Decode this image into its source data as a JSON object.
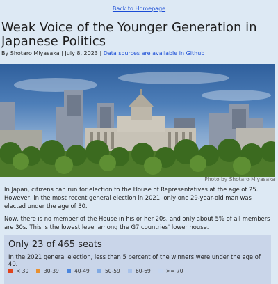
{
  "nav": {
    "back_label": "Back to Homepage"
  },
  "article": {
    "title": "Weak Voice of the Younger Generation in Japanese Politics",
    "author": "By Shotaro Miyasaka",
    "date": "July 8, 2023",
    "sources_link": "Data sources are available in Github",
    "photo_credit": "Photo by Shotaro Miyasaka",
    "paragraphs": [
      "In Japan, citizens can run for election to the House of Representatives at the age of 25. However, in the most recent general election in 2021, only one 29-year-old man was elected under the age of 30.",
      "Now, there is no member of the House in his or her 20s, and only about 5% of all members are 30s. This is the lowest level among the G7 countries' lower house."
    ]
  },
  "card": {
    "title": "Only 23 of 465 seats",
    "subtitle": "In the 2021 general election, less than 5 percent of the winners were under the age of 40.",
    "legend": [
      {
        "label": "< 30",
        "color": "#e0441c"
      },
      {
        "label": "30-39",
        "color": "#e8902f"
      },
      {
        "label": "40-49",
        "color": "#4a86de"
      },
      {
        "label": "50-59",
        "color": "#7fa9e3"
      },
      {
        "label": "60-69",
        "color": "#a8c2ea"
      },
      {
        "label": ">= 70",
        "color": "#c5d5ee"
      }
    ]
  }
}
